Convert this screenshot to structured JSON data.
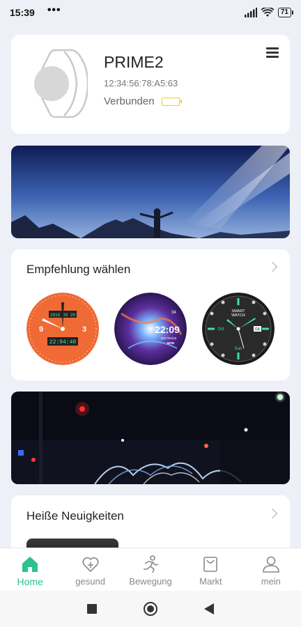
{
  "status_bar": {
    "time": "15:39",
    "dots": "•••",
    "battery": "71"
  },
  "device": {
    "name": "PRIME2",
    "mac": "12:34:56:78:A5:63",
    "status": "Verbunden"
  },
  "faces_section": {
    "title": "Empfehlung wählen",
    "faces": [
      {
        "top_display": "2016 09 20",
        "digital_time": "22:04:40"
      },
      {
        "time": "22:09",
        "date": "2017/04/16",
        "day": "MON",
        "hour_label": "34"
      },
      {
        "brand_line1": "SMART",
        "brand_line2": "WATCH",
        "month": "Oct",
        "day": "Sun",
        "date": "04"
      }
    ]
  },
  "news_section": {
    "title": "Heiße Neuigkeiten"
  },
  "bottom_nav": [
    {
      "label": "Home",
      "icon": "home-icon",
      "active": true
    },
    {
      "label": "gesund",
      "icon": "heart-plus-icon",
      "active": false
    },
    {
      "label": "Bewegung",
      "icon": "running-icon",
      "active": false
    },
    {
      "label": "Markt",
      "icon": "shopping-bag-icon",
      "active": false
    },
    {
      "label": "mein",
      "icon": "user-icon",
      "active": false
    }
  ],
  "colors": {
    "accent": "#2dc28b",
    "battery": "#f1d200",
    "background": "#eef0f7"
  }
}
